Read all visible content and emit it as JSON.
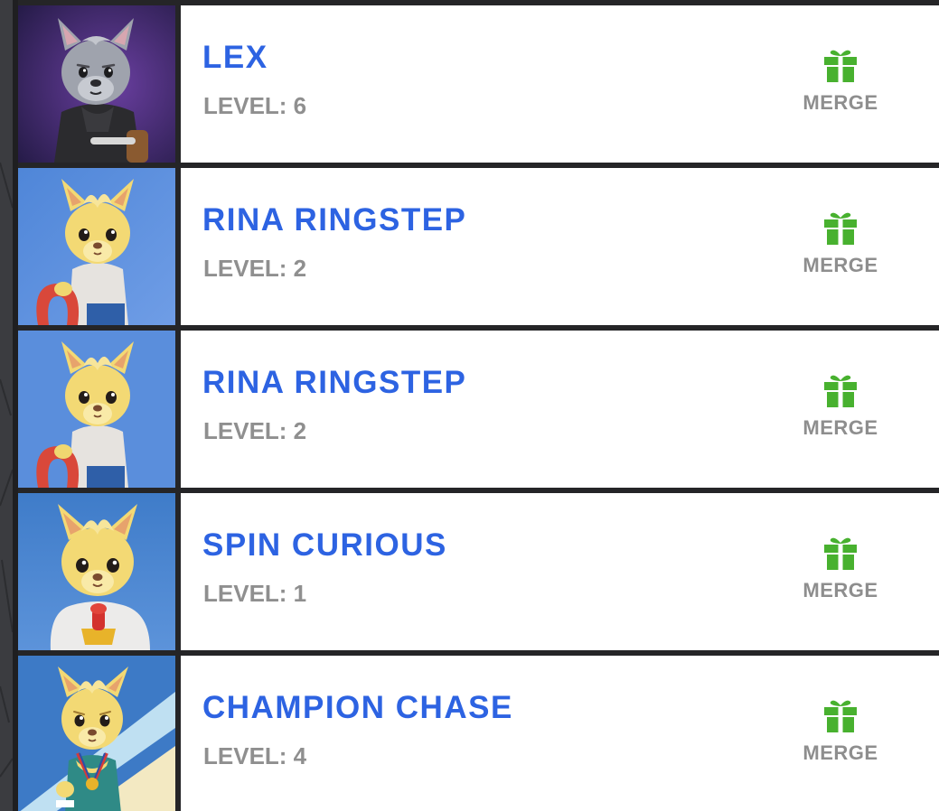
{
  "merge_label": "MERGE",
  "colors": {
    "name": "#2d63e2",
    "level": "#8f8f8f",
    "gift": "#48b12f",
    "card_bg": "#ffffff",
    "divider": "#252527"
  },
  "cards": [
    {
      "name": "LEX",
      "level": "LEVEL: 6",
      "avatar": "gray-wolf-hoodie-avatar"
    },
    {
      "name": "RINA RINGSTEP",
      "level": "LEVEL: 2",
      "avatar": "yellow-llama-ring-avatar"
    },
    {
      "name": "RINA RINGSTEP",
      "level": "LEVEL: 2",
      "avatar": "yellow-llama-ring-avatar"
    },
    {
      "name": "SPIN CURIOUS",
      "level": "LEVEL: 1",
      "avatar": "yellow-llama-toy-avatar"
    },
    {
      "name": "CHAMPION CHASE",
      "level": "LEVEL: 4",
      "avatar": "yellow-llama-medal-avatar"
    }
  ]
}
